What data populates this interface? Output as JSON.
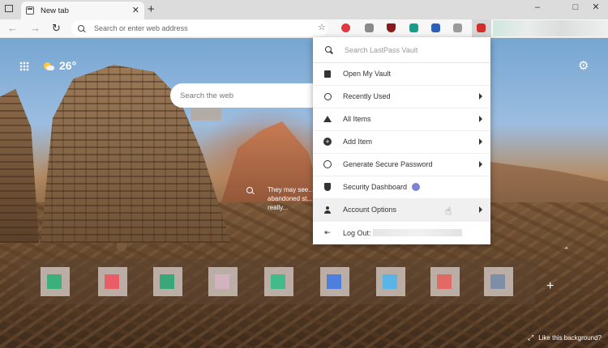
{
  "browser": {
    "tab": {
      "title": "New tab",
      "close_icon": "close-icon"
    },
    "new_tab_icon": "plus-icon",
    "window_controls": {
      "minimize": "–",
      "maximize": "□",
      "close": "✕"
    },
    "address_bar": {
      "placeholder": "Search or enter web address"
    },
    "extensions": [
      {
        "name": "red-circle-extension",
        "color": "#e2373f"
      },
      {
        "name": "notion-extension",
        "color": "#8a8a8a"
      },
      {
        "name": "ublock-extension",
        "color": "#8c1a1a"
      },
      {
        "name": "teal-extension",
        "color": "#169e8c"
      },
      {
        "name": "bitwarden-extension",
        "color": "#2c5fb8"
      },
      {
        "name": "gray-extension",
        "color": "#9a9a9a"
      },
      {
        "name": "lastpass-extension",
        "color": "#d32d27"
      }
    ]
  },
  "ntp": {
    "weather": {
      "temperature": "26",
      "unit": "°"
    },
    "search": {
      "placeholder": "Search the web"
    },
    "caption": {
      "text": "They may see... abandoned st... really..."
    },
    "quick_links_colors": [
      "#3bb07b",
      "#e85d66",
      "#3aa77a",
      "#d3b2c0",
      "#44b989",
      "#4f7fdd",
      "#59b4e8",
      "#e16a65",
      "#7d8ea6"
    ],
    "like_background": "Like this background?"
  },
  "lastpass_menu": {
    "search_placeholder": "Search LastPass Vault",
    "items": [
      {
        "label": "Open My Vault",
        "icon": "vault-icon",
        "has_submenu": false
      },
      {
        "label": "Recently Used",
        "icon": "clock-icon",
        "has_submenu": true
      },
      {
        "label": "All Items",
        "icon": "home-icon",
        "has_submenu": true
      },
      {
        "label": "Add Item",
        "icon": "plus-circle-icon",
        "has_submenu": true
      },
      {
        "label": "Generate Secure Password",
        "icon": "key-icon",
        "has_submenu": true
      },
      {
        "label": "Security Dashboard",
        "icon": "shield-icon",
        "has_submenu": false
      },
      {
        "label": "Account Options",
        "icon": "user-icon",
        "has_submenu": true
      },
      {
        "label": "Log Out:",
        "icon": "logout-icon",
        "has_submenu": false
      }
    ]
  }
}
